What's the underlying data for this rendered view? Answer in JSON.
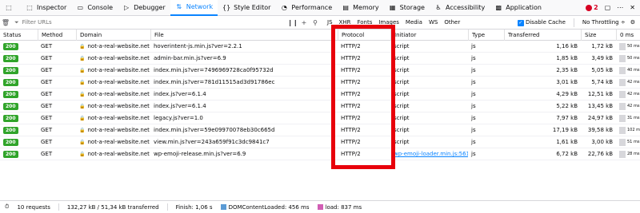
{
  "tabs": [
    {
      "label": "Inspector",
      "icon": "inspector-icon",
      "glyph": "⬚"
    },
    {
      "label": "Console",
      "icon": "console-icon",
      "glyph": "▭"
    },
    {
      "label": "Debugger",
      "icon": "debugger-icon",
      "glyph": "▷"
    },
    {
      "label": "Network",
      "icon": "network-icon",
      "glyph": "⇅",
      "active": true
    },
    {
      "label": "Style Editor",
      "icon": "style-editor-icon",
      "glyph": "{}"
    },
    {
      "label": "Performance",
      "icon": "performance-icon",
      "glyph": "◔"
    },
    {
      "label": "Memory",
      "icon": "memory-icon",
      "glyph": "▤"
    },
    {
      "label": "Storage",
      "icon": "storage-icon",
      "glyph": "▦"
    },
    {
      "label": "Accessibility",
      "icon": "accessibility-icon",
      "glyph": "♿"
    },
    {
      "label": "Application",
      "icon": "application-icon",
      "glyph": "▩"
    }
  ],
  "tabs_right": {
    "error_count": "2"
  },
  "toolbar": {
    "filter_placeholder": "Filter URLs",
    "type_filters": [
      "JS",
      "XHR",
      "Fonts",
      "Images",
      "Media",
      "WS",
      "Other"
    ],
    "disable_cache_label": "Disable Cache",
    "throttling_label": "No Throttling ÷"
  },
  "columns": [
    "Status",
    "Method",
    "Domain",
    "File",
    "Protocol",
    "Initiator",
    "Type",
    "Transferred",
    "Size",
    "0 ms"
  ],
  "rows": [
    {
      "status": "200",
      "method": "GET",
      "domain": "not-a-real-website.net",
      "file": "hoverintent-js.min.js?ver=2.2.1",
      "protocol": "HTTP/2",
      "initiator": "script",
      "type": "js",
      "transferred": "1,16 kB",
      "size": "1,72 kB",
      "time": "50 ms"
    },
    {
      "status": "200",
      "method": "GET",
      "domain": "not-a-real-website.net",
      "file": "admin-bar.min.js?ver=6.9",
      "protocol": "HTTP/2",
      "initiator": "script",
      "type": "js",
      "transferred": "1,85 kB",
      "size": "3,49 kB",
      "time": "50 ms"
    },
    {
      "status": "200",
      "method": "GET",
      "domain": "not-a-real-website.net",
      "file": "index.min.js?ver=7496969728ca0f95732d",
      "protocol": "HTTP/2",
      "initiator": "script",
      "type": "js",
      "transferred": "2,35 kB",
      "size": "5,05 kB",
      "time": "40 ms"
    },
    {
      "status": "200",
      "method": "GET",
      "domain": "not-a-real-website.net",
      "file": "index.min.js?ver=781d11515ad3d91786ec",
      "protocol": "HTTP/2",
      "initiator": "script",
      "type": "js",
      "transferred": "3,01 kB",
      "size": "5,74 kB",
      "time": "42 ms"
    },
    {
      "status": "200",
      "method": "GET",
      "domain": "not-a-real-website.net",
      "file": "index.js?ver=6.1.4",
      "protocol": "HTTP/2",
      "initiator": "script",
      "type": "js",
      "transferred": "4,29 kB",
      "size": "12,51 kB",
      "time": "42 ms"
    },
    {
      "status": "200",
      "method": "GET",
      "domain": "not-a-real-website.net",
      "file": "index.js?ver=6.1.4",
      "protocol": "HTTP/2",
      "initiator": "script",
      "type": "js",
      "transferred": "5,22 kB",
      "size": "13,45 kB",
      "time": "42 ms"
    },
    {
      "status": "200",
      "method": "GET",
      "domain": "not-a-real-website.net",
      "file": "legacy.js?ver=1.0",
      "protocol": "HTTP/2",
      "initiator": "script",
      "type": "js",
      "transferred": "7,97 kB",
      "size": "24,97 kB",
      "time": "31 ms"
    },
    {
      "status": "200",
      "method": "GET",
      "domain": "not-a-real-website.net",
      "file": "index.min.js?ver=59e09970078eb30c665d",
      "protocol": "HTTP/2",
      "initiator": "script",
      "type": "js",
      "transferred": "17,19 kB",
      "size": "39,58 kB",
      "time": "102 ms"
    },
    {
      "status": "200",
      "method": "GET",
      "domain": "not-a-real-website.net",
      "file": "view.min.js?ver=243a659f91c3dc9841c7",
      "protocol": "HTTP/2",
      "initiator": "script",
      "type": "js",
      "transferred": "1,61 kB",
      "size": "3,00 kB",
      "time": "51 ms"
    },
    {
      "status": "200",
      "method": "GET",
      "domain": "not-a-real-website.net",
      "file": "wp-emoji-release.min.js?ver=6.9",
      "protocol": "HTTP/2",
      "initiator": "wp-emoji-loader.min.js:561...",
      "type": "js",
      "transferred": "6,72 kB",
      "size": "22,76 kB",
      "time": "28 ms"
    }
  ],
  "statusbar": {
    "requests": "10 requests",
    "transferred": "132,27 kB / 51,34 kB transferred",
    "finish": "Finish: 1,06 s",
    "dom_content_loaded": "DOMContentLoaded: 456 ms",
    "load": "load: 837 ms"
  },
  "colors": {
    "accent": "#0a84ff",
    "status_ok": "#30a42a",
    "highlight": "#e8000b",
    "dcl": "#5b9bd5",
    "load": "#d15eb4"
  }
}
